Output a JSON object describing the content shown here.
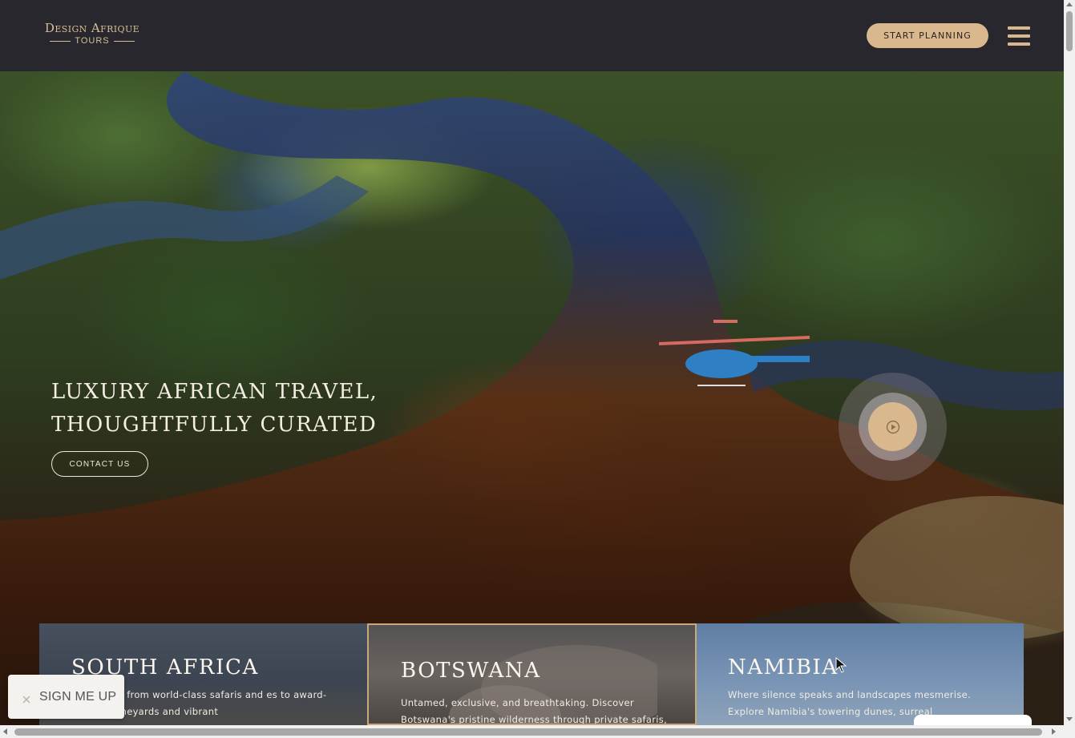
{
  "header": {
    "logo_main": "Design Afrique",
    "logo_sub": "TOURS",
    "start_planning_label": "START PLANNING",
    "menu_icon": "hamburger-menu-icon"
  },
  "hero": {
    "title_line1": "LUXURY AFRICAN TRAVEL,",
    "title_line2": "THOUGHTFULLY CURATED",
    "contact_label": "CONTACT US",
    "play_icon": "play-circle-icon"
  },
  "destinations": [
    {
      "name": "SOUTH AFRICA",
      "description": "ontrasts — from world-class safaris and es to award-winning vineyards and vibrant"
    },
    {
      "name": "BOTSWANA",
      "description": "Untamed, exclusive, and breathtaking. Discover Botswana's pristine wilderness through private safaris,"
    },
    {
      "name": "NAMIBIA",
      "description": "Where silence speaks and landscapes mesmerise. Explore Namibia's towering dunes, surreal"
    }
  ],
  "signup": {
    "label": "SIGN ME UP",
    "close_icon": "close-icon"
  },
  "colors": {
    "header_bg": "#28272e",
    "accent_gold": "#d9b88e",
    "logo_gold": "#d8bf98",
    "card_border": "#c9a979"
  }
}
